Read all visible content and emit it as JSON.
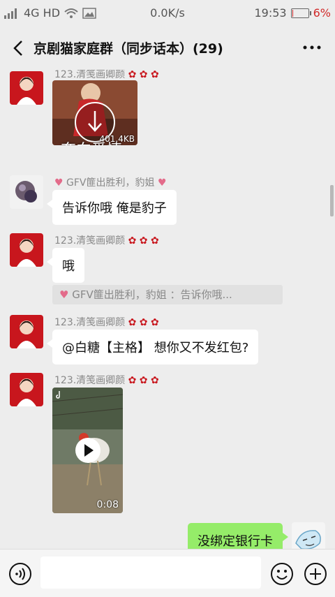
{
  "status": {
    "signal": "4G HD",
    "speed": "0.0K/s",
    "time": "19:53",
    "battery": "6%",
    "battery_level": 0.06
  },
  "header": {
    "title": "京剧猫家庭群（同步话本）(29)"
  },
  "messages": [
    {
      "sender": "123.清笺画卿颜",
      "type": "image",
      "image_caption": "奔向爱情",
      "size": "401.4KB"
    },
    {
      "sender": "GFV篚出胜利，豹姐",
      "text": "告诉你哦 俺是豹子"
    },
    {
      "sender": "123.清笺画卿颜",
      "text": "哦",
      "quote": "GFV篚出胜利，豹姐 ：告诉你哦..."
    },
    {
      "sender": "123.清笺画卿颜",
      "text": "@白糖【主格】 想你又不发红包?"
    },
    {
      "sender": "123.清笺画卿颜",
      "type": "video",
      "duration": "0:08"
    },
    {
      "self": true,
      "text": "没绑定银行卡"
    }
  ],
  "icons": {
    "back": "chevron-left-icon",
    "more": "more-dots-icon",
    "voice": "voice-icon",
    "emoji": "emoji-icon",
    "plus": "plus-icon"
  },
  "colors": {
    "self_bubble": "#95ec69",
    "bubble": "#ffffff",
    "background": "#ededed"
  }
}
